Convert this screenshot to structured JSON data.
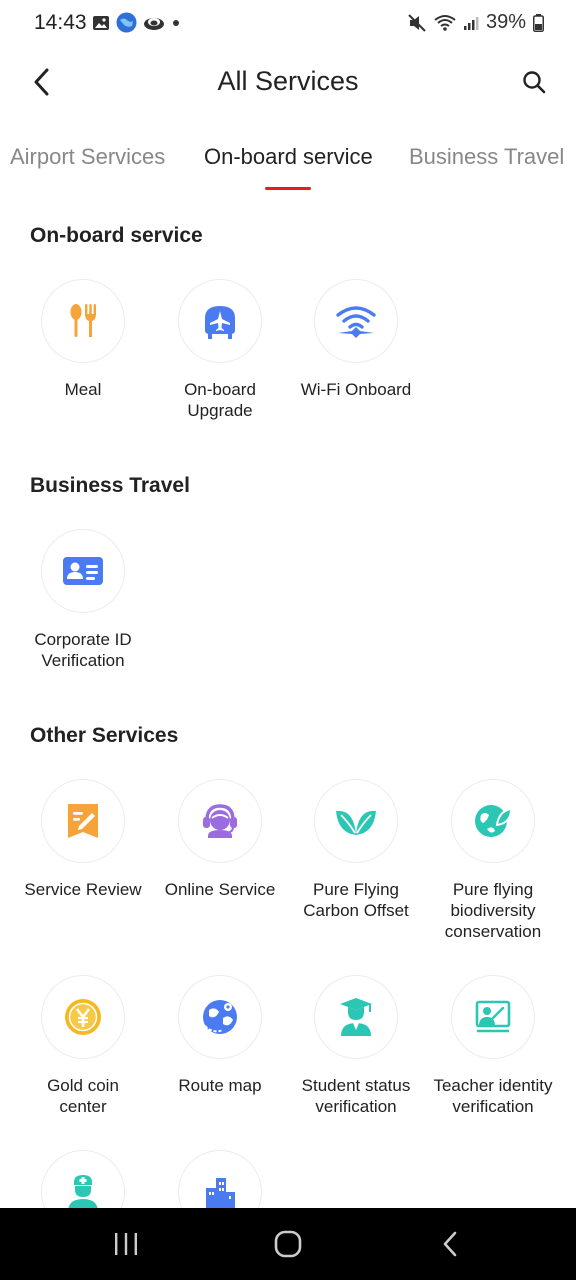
{
  "status": {
    "time": "14:43",
    "battery": "39%"
  },
  "header": {
    "title": "All Services",
    "back_icon": "chevron-left-icon",
    "search_icon": "search-icon"
  },
  "tabs": [
    {
      "label": "Airport Services",
      "active": false
    },
    {
      "label": "On-board service",
      "active": true
    },
    {
      "label": "Business Travel",
      "active": false
    }
  ],
  "sections": [
    {
      "title": "On-board service",
      "items": [
        {
          "label": "Meal",
          "icon": "meal-icon"
        },
        {
          "label": "On-board\nUpgrade",
          "icon": "upgrade-icon"
        },
        {
          "label": "Wi-Fi Onboard",
          "icon": "wifi-icon"
        }
      ]
    },
    {
      "title": "Business Travel",
      "items": [
        {
          "label": "Corporate ID\nVerification",
          "icon": "id-card-icon"
        }
      ]
    },
    {
      "title": "Other Services",
      "items": [
        {
          "label": "Service Review",
          "icon": "review-icon"
        },
        {
          "label": "Online Service",
          "icon": "headset-icon"
        },
        {
          "label": "Pure Flying\nCarbon Offset",
          "icon": "leaf-icon"
        },
        {
          "label": "Pure flying\nbiodiversity\nconservation",
          "icon": "globe-leaf-icon"
        },
        {
          "label": "Gold coin\ncenter",
          "icon": "coin-icon"
        },
        {
          "label": "Route map",
          "icon": "route-map-icon"
        },
        {
          "label": "Student status\nverification",
          "icon": "graduate-icon"
        },
        {
          "label": "Teacher identity\nverification",
          "icon": "teacher-icon"
        },
        {
          "label": "",
          "icon": "nurse-icon"
        },
        {
          "label": "",
          "icon": "city-icon"
        }
      ]
    }
  ],
  "colors": {
    "accent_red": "#e02020",
    "orange": "#f6a33a",
    "blue": "#4a7bf0",
    "purple": "#9b6be0",
    "teal": "#2cc6b5",
    "gold": "#f5b820"
  }
}
